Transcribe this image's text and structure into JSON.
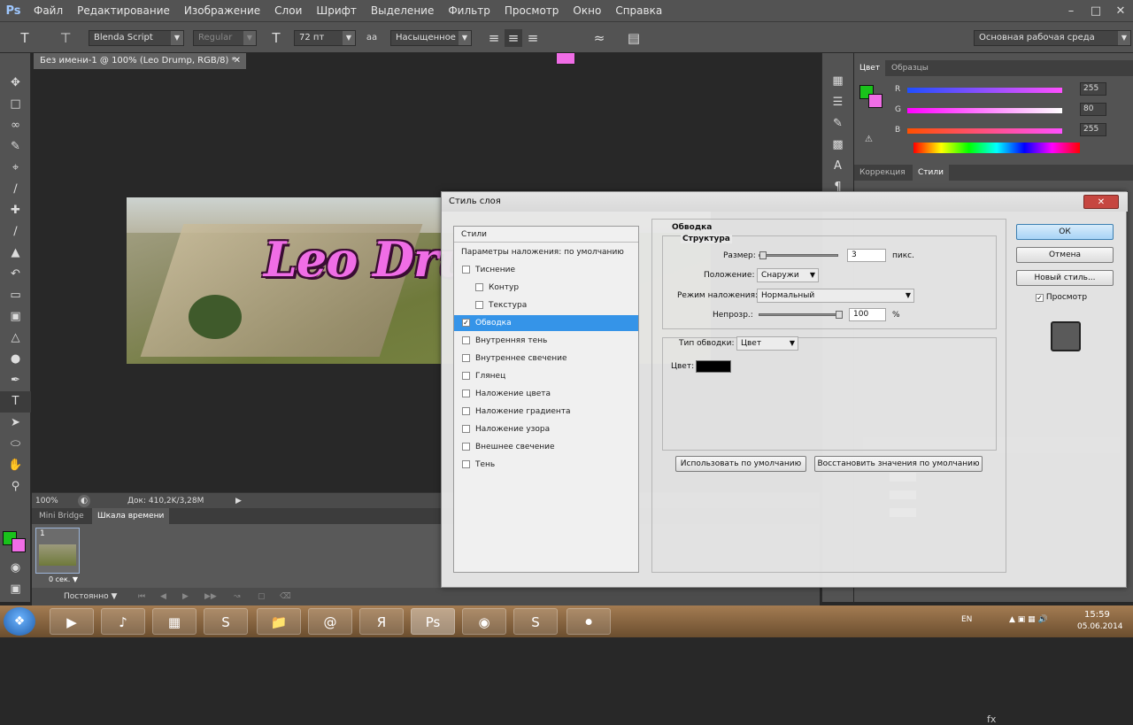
{
  "app": {
    "logo": "Ps",
    "menu": [
      "Файл",
      "Редактирование",
      "Изображение",
      "Слои",
      "Шрифт",
      "Выделение",
      "Фильтр",
      "Просмотр",
      "Окно",
      "Справка"
    ]
  },
  "options": {
    "font_family": "Blenda Script",
    "font_style": "Regular",
    "font_size": "72 пт",
    "antialias": "Насыщенное",
    "text_color": "#f06de6",
    "workspace": "Основная рабочая среда"
  },
  "document": {
    "tab_title": "Без имени-1 @ 100% (Leo Drump, RGB/8) *",
    "canvas_text": "Leo Drump",
    "zoom": "100%",
    "doc_size": "Док: 410,2K/3,28M"
  },
  "timeline": {
    "tabs": [
      "Mini Bridge",
      "Шкала времени"
    ],
    "frame_number": "1",
    "frame_delay": "0 сек.",
    "loop": "Постоянно"
  },
  "color_panel": {
    "tabs": [
      "Цвет",
      "Образцы"
    ],
    "r": {
      "label": "R",
      "value": "255"
    },
    "g": {
      "label": "G",
      "value": "80"
    },
    "b": {
      "label": "B",
      "value": "255"
    },
    "fg_color": "#19c21b",
    "bg_color": "#f06de6"
  },
  "styles_panel": {
    "tabs": [
      "Коррекция",
      "Стили"
    ]
  },
  "dialog": {
    "title": "Стиль слоя",
    "list_header": "Стили",
    "blend_defaults": "Параметры наложения: по умолчанию",
    "items": [
      {
        "label": "Тиснение",
        "checked": false
      },
      {
        "label": "Контур",
        "checked": false
      },
      {
        "label": "Текстура",
        "checked": false
      },
      {
        "label": "Обводка",
        "checked": true
      },
      {
        "label": "Внутренняя тень",
        "checked": false
      },
      {
        "label": "Внутреннее свечение",
        "checked": false
      },
      {
        "label": "Глянец",
        "checked": false
      },
      {
        "label": "Наложение цвета",
        "checked": false
      },
      {
        "label": "Наложение градиента",
        "checked": false
      },
      {
        "label": "Наложение узора",
        "checked": false
      },
      {
        "label": "Внешнее свечение",
        "checked": false
      },
      {
        "label": "Тень",
        "checked": false
      }
    ],
    "section_title": "Обводка",
    "structure_title": "Структура",
    "size_label": "Размер:",
    "size_value": "3",
    "size_unit": "пикс.",
    "position_label": "Положение:",
    "position_value": "Снаружи",
    "blend_label": "Режим наложения:",
    "blend_value": "Нормальный",
    "opacity_label": "Непрозр.:",
    "opacity_value": "100",
    "opacity_unit": "%",
    "fill_type_label": "Тип обводки:",
    "fill_type_value": "Цвет",
    "color_label": "Цвет:",
    "stroke_color": "#000000",
    "btn_default": "Использовать по умолчанию",
    "btn_reset": "Восстановить значения по умолчанию",
    "btn_ok": "ОК",
    "btn_cancel": "Отмена",
    "btn_new_style": "Новый стиль...",
    "preview_label": "Просмотр"
  },
  "taskbar": {
    "lang": "EN",
    "time": "15:59",
    "date": "05.06.2014"
  }
}
